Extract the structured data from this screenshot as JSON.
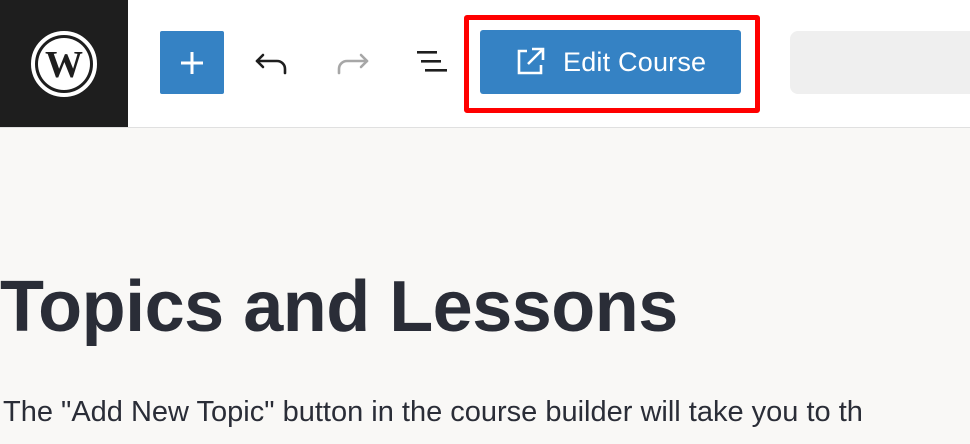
{
  "toolbar": {
    "logo_icon": "wordpress-logo-icon",
    "inserter_icon": "plus-icon",
    "undo_icon": "undo-icon",
    "redo_icon": "redo-icon",
    "outline_icon": "document-outline-icon",
    "edit_course": {
      "label": "Edit Course",
      "icon": "external-link-icon"
    },
    "colors": {
      "accent": "#3582c4",
      "highlight": "#ff0000",
      "logo_bg": "#1e1e1e"
    }
  },
  "content": {
    "title": "Topics and Lessons",
    "paragraph": "The \"Add New Topic\" button in the course builder will take you to th"
  }
}
